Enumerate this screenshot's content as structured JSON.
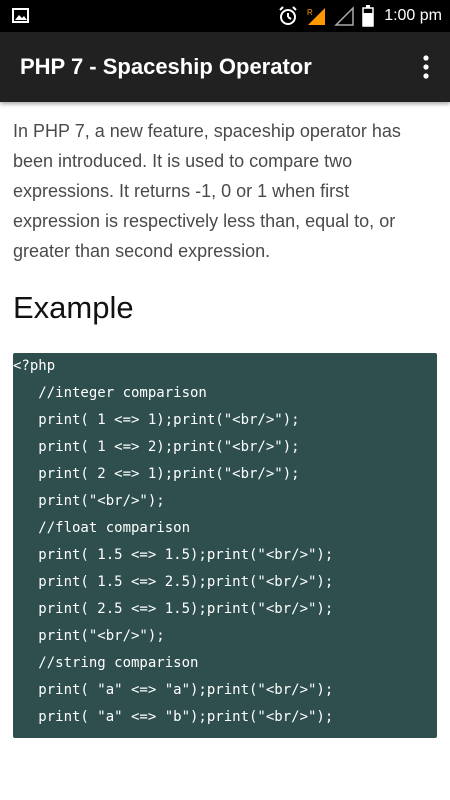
{
  "status_bar": {
    "time": "1:00 pm",
    "icons": [
      "gallery-icon",
      "alarm-icon",
      "signal-roaming-icon",
      "signal-empty-icon",
      "battery-icon"
    ]
  },
  "app_bar": {
    "title": "PHP 7 - Spaceship Operator",
    "menu_icon": "more-vert-icon"
  },
  "content": {
    "intro": "In PHP 7, a new feature, spaceship operator has been introduced. It is used to compare two expressions. It returns -1, 0 or 1 when first expression is respectively less than, equal to, or greater than second expression.",
    "heading": "Example",
    "code_lines": [
      "<?php",
      "   //integer comparison",
      "   print( 1 <=> 1);print(\"<br/>\");",
      "   print( 1 <=> 2);print(\"<br/>\");",
      "   print( 2 <=> 1);print(\"<br/>\");",
      "   print(\"<br/>\");",
      "   //float comparison",
      "   print( 1.5 <=> 1.5);print(\"<br/>\");",
      "   print( 1.5 <=> 2.5);print(\"<br/>\");",
      "   print( 2.5 <=> 1.5);print(\"<br/>\");",
      "   print(\"<br/>\");",
      "   //string comparison",
      "   print( \"a\" <=> \"a\");print(\"<br/>\");",
      "   print( \"a\" <=> \"b\");print(\"<br/>\");"
    ]
  },
  "colors": {
    "status_bar": "#000000",
    "app_bar": "#212121",
    "code_background": "#2f4f4f",
    "body_text": "#4a4a4a"
  }
}
